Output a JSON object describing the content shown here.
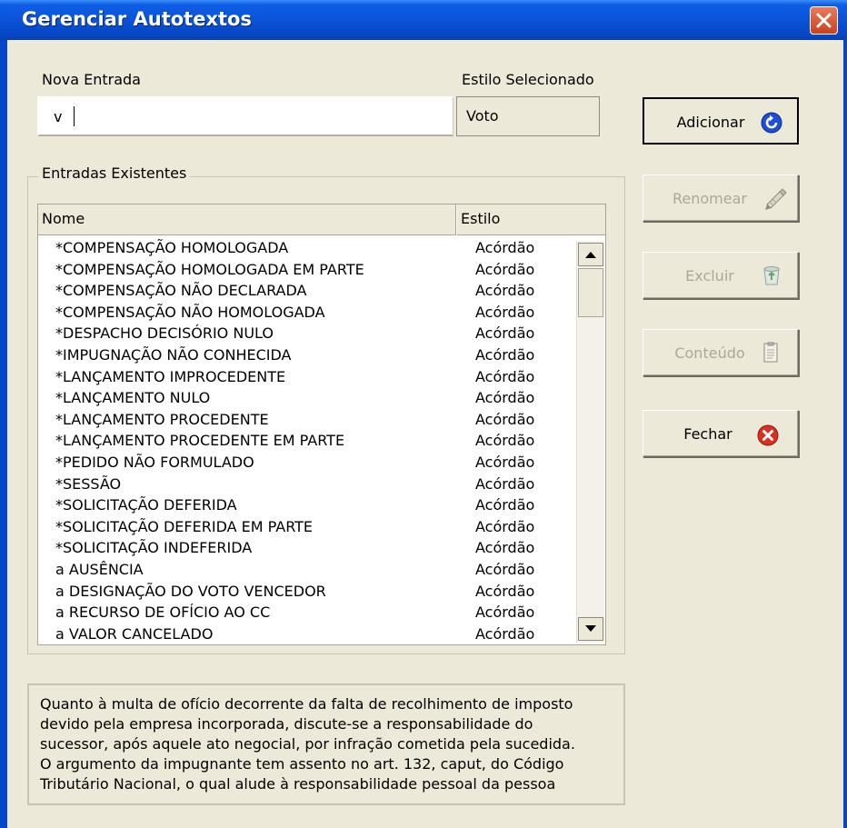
{
  "window": {
    "title": "Gerenciar Autotextos"
  },
  "nova_entrada": {
    "label": "Nova Entrada",
    "value": "v"
  },
  "estilo_selecionado": {
    "label": "Estilo Selecionado",
    "value": "Voto"
  },
  "entradas": {
    "label": "Entradas Existentes",
    "columns": [
      "Nome",
      "Estilo"
    ],
    "rows": [
      {
        "nome": "*COMPENSAÇÃO HOMOLOGADA",
        "estilo": "Acórdão"
      },
      {
        "nome": "*COMPENSAÇÃO HOMOLOGADA EM PARTE",
        "estilo": "Acórdão"
      },
      {
        "nome": "*COMPENSAÇÃO NÃO DECLARADA",
        "estilo": "Acórdão"
      },
      {
        "nome": "*COMPENSAÇÃO NÃO HOMOLOGADA",
        "estilo": "Acórdão"
      },
      {
        "nome": "*DESPACHO DECISÓRIO NULO",
        "estilo": "Acórdão"
      },
      {
        "nome": "*IMPUGNAÇÃO NÃO CONHECIDA",
        "estilo": "Acórdão"
      },
      {
        "nome": "*LANÇAMENTO IMPROCEDENTE",
        "estilo": "Acórdão"
      },
      {
        "nome": "*LANÇAMENTO NULO",
        "estilo": "Acórdão"
      },
      {
        "nome": "*LANÇAMENTO PROCEDENTE",
        "estilo": "Acórdão"
      },
      {
        "nome": "*LANÇAMENTO PROCEDENTE EM PARTE",
        "estilo": "Acórdão"
      },
      {
        "nome": "*PEDIDO NÃO FORMULADO",
        "estilo": "Acórdão"
      },
      {
        "nome": "*SESSÃO",
        "estilo": "Acórdão"
      },
      {
        "nome": "*SOLICITAÇÃO DEFERIDA",
        "estilo": "Acórdão"
      },
      {
        "nome": "*SOLICITAÇÃO DEFERIDA EM PARTE",
        "estilo": "Acórdão"
      },
      {
        "nome": "*SOLICITAÇÃO INDEFERIDA",
        "estilo": "Acórdão"
      },
      {
        "nome": "a AUSÊNCIA",
        "estilo": "Acórdão"
      },
      {
        "nome": "a DESIGNAÇÃO DO VOTO VENCEDOR",
        "estilo": "Acórdão"
      },
      {
        "nome": "a RECURSO DE OFÍCIO AO CC",
        "estilo": "Acórdão"
      },
      {
        "nome": "a VALOR CANCELADO",
        "estilo": "Acórdão"
      }
    ]
  },
  "buttons": {
    "adicionar": "Adicionar",
    "renomear": "Renomear",
    "excluir": "Excluir",
    "conteudo": "Conteúdo",
    "fechar": "Fechar"
  },
  "icons": {
    "adicionar": "blue-circular-arrow-icon",
    "renomear": "pencil-edit-icon",
    "excluir": "recycle-bin-icon",
    "conteudo": "document-icon",
    "fechar": "red-x-circle-icon"
  },
  "preview": {
    "lines": [
      "Quanto à multa de ofício decorrente da falta de recolhimento de imposto",
      "devido pela empresa incorporada, discute-se a responsabilidade do",
      "sucessor, após aquele ato negocial, por infração cometida pela sucedida.",
      "O argumento da impugnante tem assento no art. 132, caput, do Código",
      "Tributário Nacional, o qual alude à responsabilidade pessoal da pessoa"
    ]
  }
}
